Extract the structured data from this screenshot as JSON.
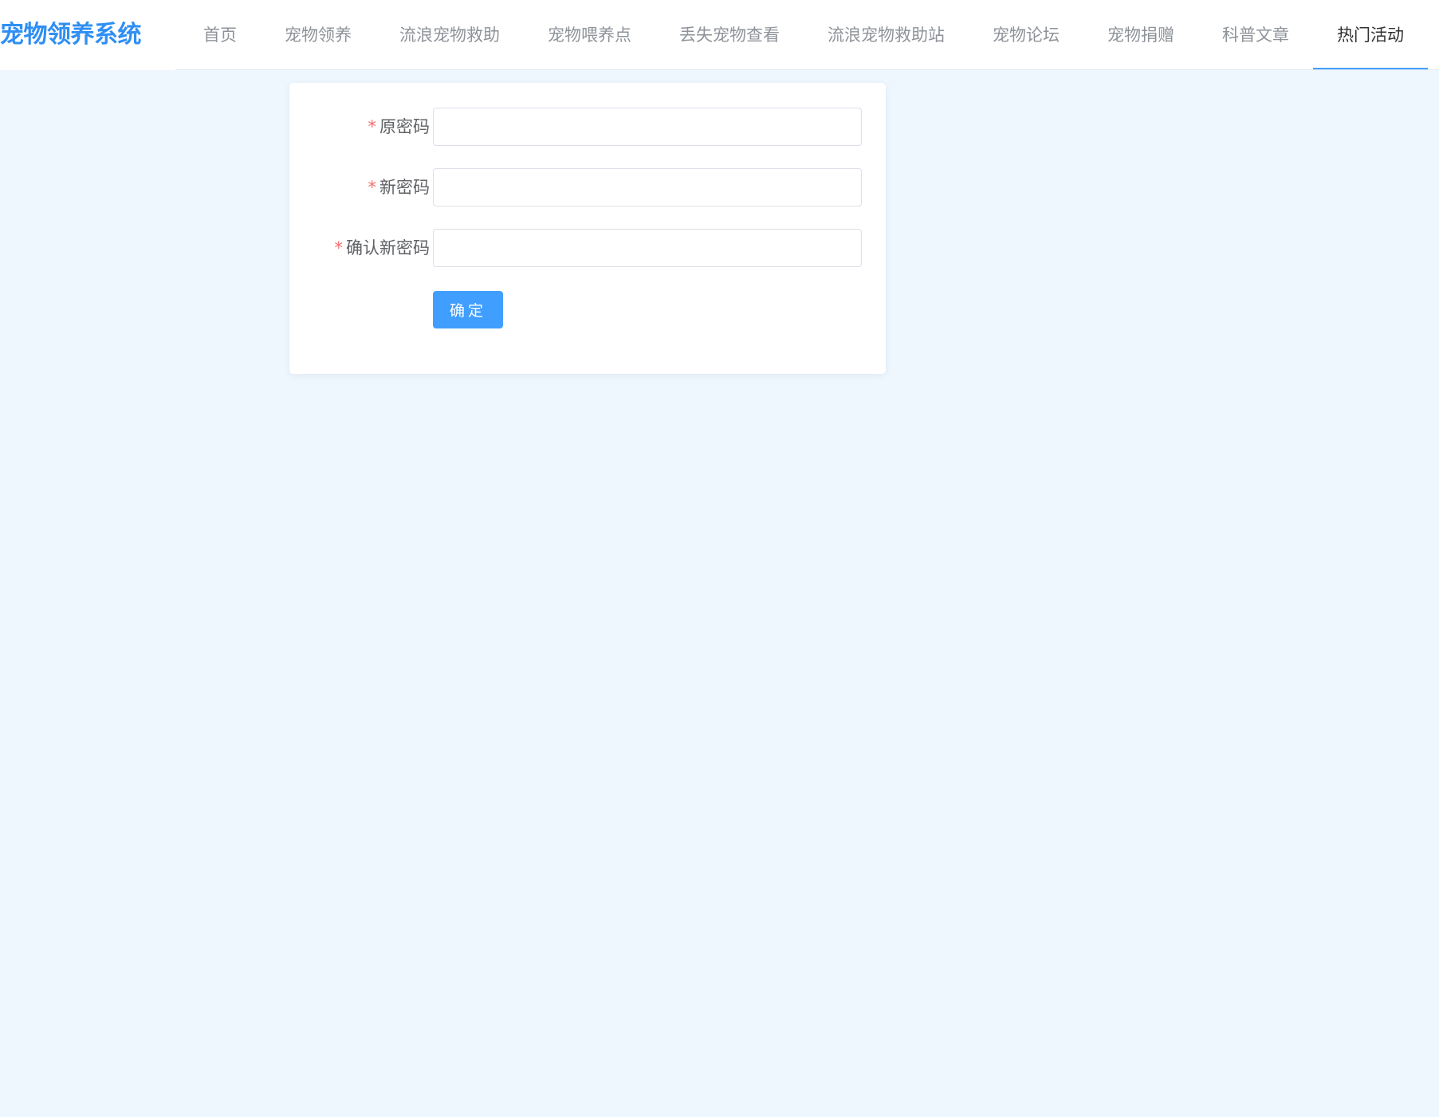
{
  "header": {
    "logo": "宠物领养系统",
    "nav": [
      {
        "label": "首页"
      },
      {
        "label": "宠物领养"
      },
      {
        "label": "流浪宠物救助"
      },
      {
        "label": "宠物喂养点"
      },
      {
        "label": "丢失宠物查看"
      },
      {
        "label": "流浪宠物救助站"
      },
      {
        "label": "宠物论坛"
      },
      {
        "label": "宠物捐赠"
      },
      {
        "label": "科普文章"
      },
      {
        "label": "热门活动"
      }
    ],
    "active_index": 9
  },
  "form": {
    "required_mark": "*",
    "fields": [
      {
        "label": "原密码",
        "value": ""
      },
      {
        "label": "新密码",
        "value": ""
      },
      {
        "label": "确认新密码",
        "value": ""
      }
    ],
    "submit_label": "确定"
  },
  "colors": {
    "brand": "#2f8ff3",
    "accent": "#409eff",
    "required": "#f56c6c",
    "page_background": "#eef6fe"
  }
}
